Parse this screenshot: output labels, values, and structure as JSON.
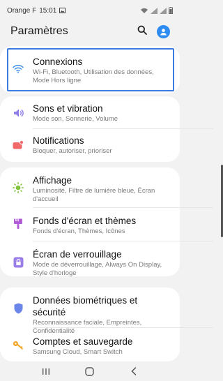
{
  "status": {
    "carrier": "Orange F",
    "time": "15:01"
  },
  "header": {
    "title": "Paramètres"
  },
  "items": [
    {
      "label": "Connexions",
      "sub": "Wi-Fi, Bluetooth, Utilisation des données, Mode Hors ligne",
      "icon": "wifi-icon",
      "color": "#3d8ce8"
    },
    {
      "label": "Sons et vibration",
      "sub": "Mode son, Sonnerie, Volume",
      "icon": "speaker-icon",
      "color": "#8f7fe6"
    },
    {
      "label": "Notifications",
      "sub": "Bloquer, autoriser, prioriser",
      "icon": "notification-icon",
      "color": "#f06a6a"
    },
    {
      "label": "Affichage",
      "sub": "Luminosité, Filtre de lumière bleue, Écran d'accueil",
      "icon": "brightness-icon",
      "color": "#7fc23b"
    },
    {
      "label": "Fonds d'écran et thèmes",
      "sub": "Fonds d'écran, Thèmes, Icônes",
      "icon": "brush-icon",
      "color": "#b35cd8"
    },
    {
      "label": "Écran de verrouillage",
      "sub": "Mode de déverrouillage, Always On Display, Style d'horloge",
      "icon": "lock-icon",
      "color": "#9a7de6"
    },
    {
      "label": "Données biométriques et sécurité",
      "sub": "Reconnaissance faciale, Empreintes, Confidentialité",
      "icon": "shield-icon",
      "color": "#6b86e8"
    },
    {
      "label": "Comptes et sauvegarde",
      "sub": "Samsung Cloud, Smart Switch",
      "icon": "key-icon",
      "color": "#f2a82b"
    }
  ]
}
